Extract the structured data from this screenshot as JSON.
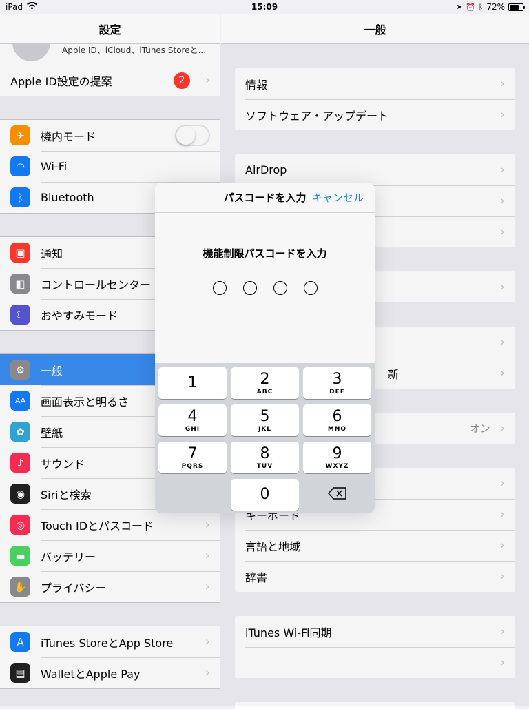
{
  "status": {
    "device": "iPad",
    "time": "15:09",
    "battery": "72%",
    "battery_level": 0.72
  },
  "left": {
    "title": "設定",
    "profile_subtitle": "Apple ID、iCloud、iTunes Storeと...",
    "suggest": {
      "label": "Apple ID設定の提案",
      "badge": "2"
    },
    "group1": [
      {
        "label": "機内モード",
        "icon": "airplane-icon",
        "color": "#ff9500"
      },
      {
        "label": "Wi-Fi",
        "icon": "wifi-icon",
        "color": "#147efb"
      },
      {
        "label": "Bluetooth",
        "icon": "bluetooth-icon",
        "color": "#147efb"
      }
    ],
    "group2": [
      {
        "label": "通知",
        "icon": "notifications-icon",
        "color": "#ff3b30"
      },
      {
        "label": "コントロールセンター",
        "icon": "control-center-icon",
        "color": "#8e8e93"
      },
      {
        "label": "おやすみモード",
        "icon": "moon-icon",
        "color": "#5856d6"
      }
    ],
    "group3": [
      {
        "label": "一般",
        "icon": "gear-icon",
        "color": "#8e8e93",
        "selected": true
      },
      {
        "label": "画面表示と明るさ",
        "icon": "display-icon",
        "color": "#147efb"
      },
      {
        "label": "壁紙",
        "icon": "wallpaper-icon",
        "color": "#34aadc"
      },
      {
        "label": "サウンド",
        "icon": "sound-icon",
        "color": "#ff2d55"
      },
      {
        "label": "Siriと検索",
        "icon": "siri-icon",
        "color": "#222222"
      },
      {
        "label": "Touch IDとパスコード",
        "icon": "fingerprint-icon",
        "color": "#ff2d55"
      },
      {
        "label": "バッテリー",
        "icon": "battery-icon",
        "color": "#4cd964"
      },
      {
        "label": "プライバシー",
        "icon": "hand-icon",
        "color": "#8e8e93"
      }
    ],
    "group4": [
      {
        "label": "iTunes StoreとApp Store",
        "icon": "app-store-icon",
        "color": "#147efb"
      },
      {
        "label": "WalletとApple Pay",
        "icon": "wallet-icon",
        "color": "#222222"
      }
    ]
  },
  "right": {
    "title": "一般",
    "group1": [
      "情報",
      "ソフトウェア・アップデート"
    ],
    "group2": [
      "AirDrop",
      "",
      ""
    ],
    "group3": [
      ""
    ],
    "group4": [
      "",
      "新"
    ],
    "group5": {
      "label": "",
      "value": "オン"
    },
    "group6": [
      "",
      "キーボード",
      "言語と地域",
      "辞書"
    ],
    "group7": [
      "iTunes Wi-Fi同期",
      ""
    ]
  },
  "modal": {
    "title": "パスコードを入力",
    "cancel": "キャンセル",
    "prompt": "機能制限パスコードを入力",
    "keys": [
      {
        "num": "1",
        "letters": ""
      },
      {
        "num": "2",
        "letters": "ABC"
      },
      {
        "num": "3",
        "letters": "DEF"
      },
      {
        "num": "4",
        "letters": "GHI"
      },
      {
        "num": "5",
        "letters": "JKL"
      },
      {
        "num": "6",
        "letters": "MNO"
      },
      {
        "num": "7",
        "letters": "PQRS"
      },
      {
        "num": "8",
        "letters": "TUV"
      },
      {
        "num": "9",
        "letters": "WXYZ"
      },
      {
        "num": "0",
        "letters": ""
      }
    ]
  }
}
